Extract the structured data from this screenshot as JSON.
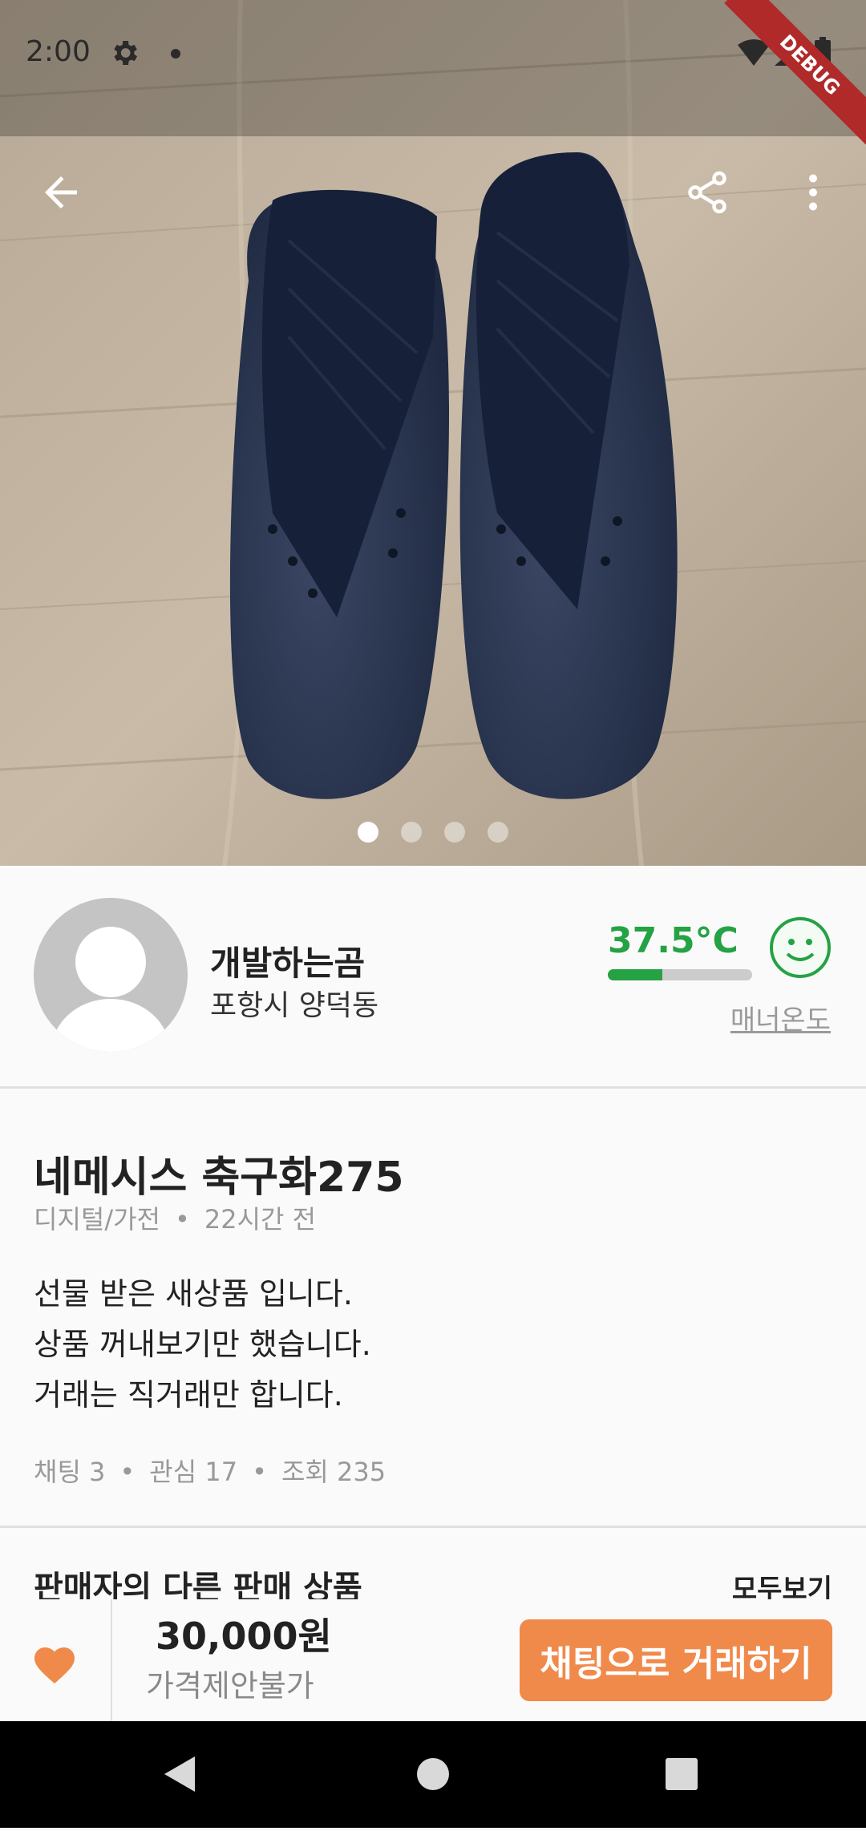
{
  "status_bar": {
    "time": "2:00",
    "debug_label": "DEBUG"
  },
  "carousel": {
    "page_count": 4,
    "active_index": 0
  },
  "seller": {
    "name": "개발하는곰",
    "location": "포항시 양덕동",
    "temperature": "37.5°C",
    "temperature_level": 0.375,
    "manner_label": "매너온도"
  },
  "product": {
    "title": "네메시스 축구화275",
    "category": "디지털/가전",
    "time_ago": "22시간 전",
    "description_lines": [
      "선물 받은 새상품 입니다.",
      "상품 꺼내보기만 했습니다.",
      "거래는 직거래만 합니다."
    ],
    "stats": {
      "chats": "채팅 3",
      "likes": "관심 17",
      "views": "조회 235"
    }
  },
  "other_products": {
    "title": "판매자의 다른 판매 상품",
    "see_all": "모두보기"
  },
  "bottom_bar": {
    "price": "30,000원",
    "negotiation": "가격제안불가",
    "chat_button": "채팅으로 거래하기"
  },
  "colors": {
    "accent": "#f08a4b",
    "temperature": "#25a244",
    "heart": "#f08a4b"
  }
}
